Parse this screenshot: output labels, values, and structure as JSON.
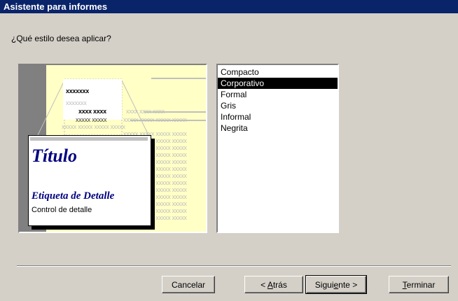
{
  "window": {
    "title": "Asistente para informes"
  },
  "question": "¿Qué estilo desea aplicar?",
  "preview": {
    "header_x": "xxxxxxx",
    "subheader_x": "xxxxxxx",
    "col_bold_1": "xxxx xxxx",
    "col_light_1": "xxxx xxxx xxxx",
    "col_bold_2": "xxxxx xxxxx",
    "row_x": "xxxxx xxxxx xxxxx xxxxx",
    "detail_title": "Título",
    "detail_label": "Etiqueta de Detalle",
    "detail_control": "Control de detalle"
  },
  "styles": {
    "items": [
      "Compacto",
      "Corporativo",
      "Formal",
      "Gris",
      "Informal",
      "Negrita"
    ],
    "selected": "Corporativo"
  },
  "buttons": {
    "cancel": "Cancelar",
    "back_prefix": "< ",
    "back_accel": "A",
    "back_rest": "trás",
    "next_prefix": "Sigui",
    "next_accel": "e",
    "next_rest": "nte >",
    "finish_accel": "T",
    "finish_rest": "erminar"
  }
}
